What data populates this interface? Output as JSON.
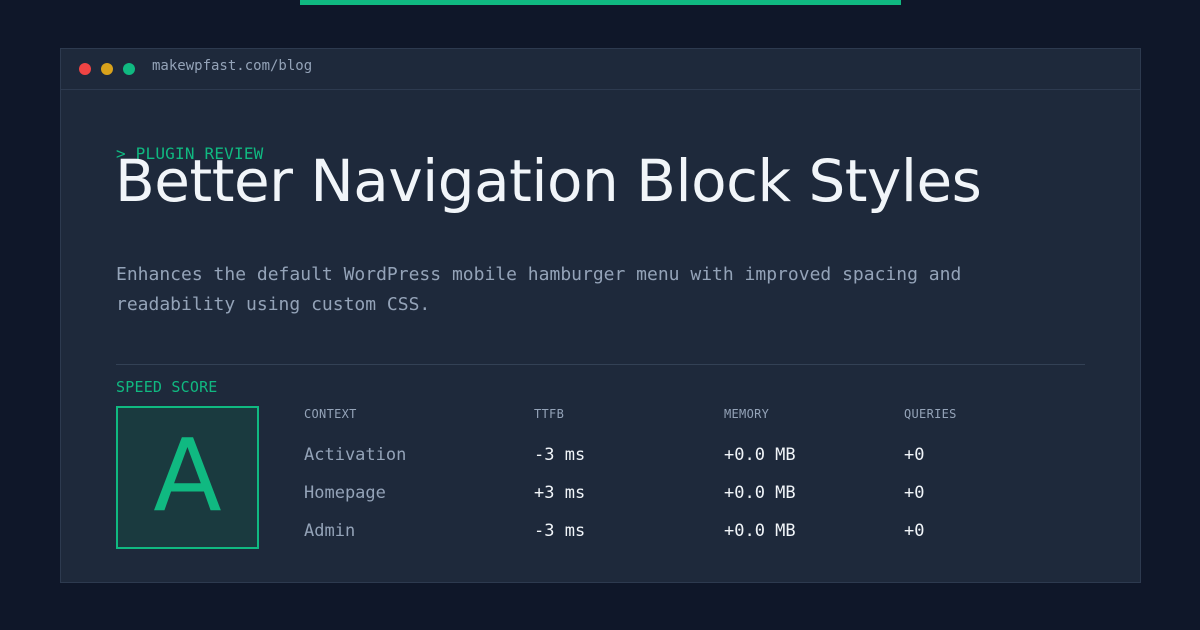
{
  "window": {
    "url": "makewpfast.com/blog"
  },
  "post": {
    "category": "> PLUGIN REVIEW",
    "title": "Better Navigation Block Styles",
    "description": "Enhances the default WordPress mobile hamburger menu with improved spacing and readability using custom CSS."
  },
  "score": {
    "label": "SPEED SCORE",
    "grade": "A"
  },
  "metrics": {
    "headers": [
      "CONTEXT",
      "TTFB",
      "MEMORY",
      "QUERIES"
    ],
    "rows": [
      {
        "context": "Activation",
        "ttfb": "-3 ms",
        "memory": "+0.0 MB",
        "queries": "+0"
      },
      {
        "context": "Homepage",
        "ttfb": "+3 ms",
        "memory": "+0.0 MB",
        "queries": "+0"
      },
      {
        "context": "Admin",
        "ttfb": "-3 ms",
        "memory": "+0.0 MB",
        "queries": "+0"
      }
    ]
  },
  "colors": {
    "background": "#0f1729",
    "panel": "#1e293b",
    "accent": "#10b981",
    "text": "#f1f5f9",
    "muted": "#94a3b8"
  }
}
